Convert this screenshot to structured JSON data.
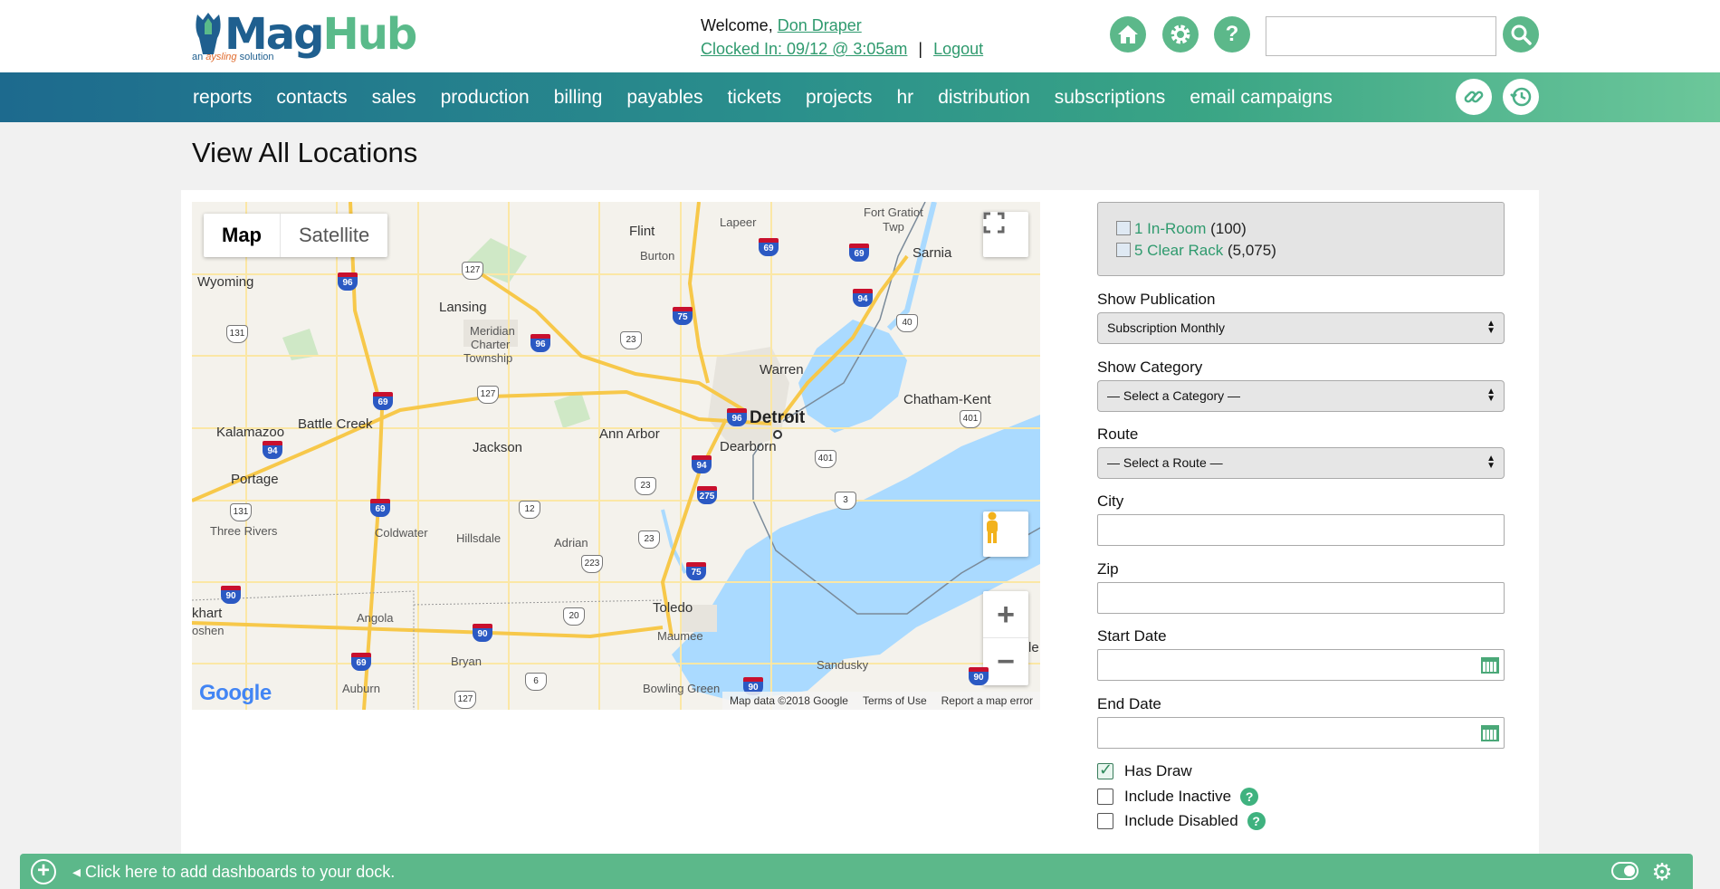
{
  "brand": {
    "name_part1": "Mag",
    "name_part2": "Hub",
    "tagline_prefix": "an ",
    "tagline_brand": "aysling",
    "tagline_suffix": " solution"
  },
  "header": {
    "welcome_prefix": "Welcome, ",
    "user_name": "Don Draper",
    "clocked_in": "Clocked In: 09/12 @ 3:05am",
    "separator": "|",
    "logout": "Logout",
    "search_value": ""
  },
  "nav": {
    "items": [
      "reports",
      "contacts",
      "sales",
      "production",
      "billing",
      "payables",
      "tickets",
      "projects",
      "hr",
      "distribution",
      "subscriptions",
      "email campaigns"
    ]
  },
  "page": {
    "title": "View All Locations"
  },
  "map": {
    "tab_map": "Map",
    "tab_satellite": "Satellite",
    "zoom_in": "+",
    "zoom_out": "−",
    "footer_data": "Map data ©2018 Google",
    "footer_terms": "Terms of Use",
    "footer_report": "Report a map error",
    "google": "Google",
    "places": {
      "flint": "Flint",
      "lapeer": "Lapeer",
      "fort_gratiot": "Fort Gratiot",
      "twp": "Twp",
      "sarnia": "Sarnia",
      "burton": "Burton",
      "wyoming": "Wyoming",
      "lansing": "Lansing",
      "meridian": "Meridian",
      "charter": "Charter",
      "township": "Township",
      "warren": "Warren",
      "detroit": "Detroit",
      "chatham_kent": "Chatham-Kent",
      "battle_creek": "Battle Creek",
      "kalamazoo": "Kalamazoo",
      "ann_arbor": "Ann Arbor",
      "dearborn": "Dearborn",
      "jackson": "Jackson",
      "portage": "Portage",
      "three_rivers": "Three Rivers",
      "coldwater": "Coldwater",
      "hillsdale": "Hillsdale",
      "adrian": "Adrian",
      "khart": "khart",
      "oshen": "oshen",
      "angola": "Angola",
      "toledo": "Toledo",
      "maumee": "Maumee",
      "bryan": "Bryan",
      "sandusky": "Sandusky",
      "bowling_green": "Bowling Green",
      "auburn": "Auburn",
      "le": "le"
    },
    "shields": {
      "s127a": "127",
      "s131a": "131",
      "s23a": "23",
      "s40": "40",
      "s127b": "127",
      "s401a": "401",
      "s401b": "401",
      "s23b": "23",
      "s12": "12",
      "s3": "3",
      "s131b": "131",
      "s23c": "23",
      "s223": "223",
      "s20": "20",
      "s6": "6",
      "s127c": "127"
    },
    "interstates": {
      "i69a": "69",
      "i69b": "69",
      "i96a": "96",
      "i75a": "75",
      "i96b": "96",
      "i94a": "94",
      "i69c": "69",
      "i96c": "96",
      "i94b": "94",
      "i94c": "94",
      "i275": "275",
      "i69d": "69",
      "i75b": "75",
      "i90a": "90",
      "i90b": "90",
      "i69e": "69",
      "i90c": "90",
      "i90d": "90"
    }
  },
  "legend": {
    "items": [
      {
        "label": "1 In-Room",
        "count": "(100)"
      },
      {
        "label": "5 Clear Rack",
        "count": "(5,075)"
      }
    ]
  },
  "form": {
    "publication_label": "Show Publication",
    "publication_value": "Subscription Monthly",
    "category_label": "Show Category",
    "category_value": "— Select a Category —",
    "route_label": "Route",
    "route_value": "— Select a Route —",
    "city_label": "City",
    "city_value": "",
    "zip_label": "Zip",
    "zip_value": "",
    "start_label": "Start Date",
    "start_value": "",
    "end_label": "End Date",
    "end_value": "",
    "has_draw_label": "Has Draw",
    "has_draw_checked": true,
    "include_inactive_label": "Include Inactive",
    "include_disabled_label": "Include Disabled",
    "help_glyph": "?"
  },
  "dock": {
    "text": "Click here to add dashboards to your dock."
  },
  "colors": {
    "accent": "#5cb88a",
    "link": "#2f9a6e",
    "nav_start": "#1d6a8e",
    "nav_end": "#6cc79a"
  }
}
